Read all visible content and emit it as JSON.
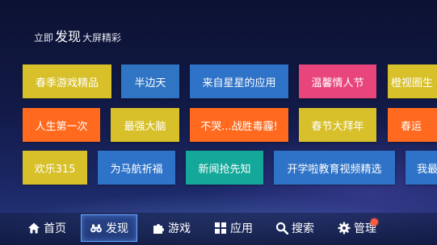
{
  "header": {
    "prefix": "立即",
    "emphasis": "发现",
    "suffix": "大屏精彩"
  },
  "tiles": [
    {
      "label": "春季游戏精品",
      "color": "#d8c02a"
    },
    {
      "label": "半边天",
      "color": "#2f75c4"
    },
    {
      "label": "来自星星的应用",
      "color": "#2f73c8"
    },
    {
      "label": "温馨情人节",
      "color": "#e8457c"
    },
    {
      "label": "橙视圈生",
      "color": "#d8c02a"
    },
    {
      "label": "人生第一次",
      "color": "#ff6a1e"
    },
    {
      "label": "最强大脑",
      "color": "#d8c02a"
    },
    {
      "label": "不哭...战胜毒霾!",
      "color": "#ff6a1e"
    },
    {
      "label": "春节大拜年",
      "color": "#d8c02a"
    },
    {
      "label": "春运",
      "color": "#ff6a1e"
    },
    {
      "label": "欢乐315",
      "color": "#d8c02a"
    },
    {
      "label": "为马航祈福",
      "color": "#2f73c8"
    },
    {
      "label": "新闻抢先知",
      "color": "#13a89a"
    },
    {
      "label": "开学啦教育视频精选",
      "color": "#2f73c8"
    },
    {
      "label": "我最",
      "color": "#2f73c8"
    }
  ],
  "nav": [
    {
      "label": "首页",
      "icon": "home-icon",
      "active": false
    },
    {
      "label": "发现",
      "icon": "binoculars-icon",
      "active": true
    },
    {
      "label": "游戏",
      "icon": "puzzle-icon",
      "active": false
    },
    {
      "label": "应用",
      "icon": "apps-grid-icon",
      "active": false
    },
    {
      "label": "搜索",
      "icon": "search-icon",
      "active": false
    },
    {
      "label": "管理",
      "icon": "gear-icon",
      "active": false,
      "badge": true
    }
  ],
  "colors": {
    "accent": "#6aa8ff",
    "badge": "#ff5b3d"
  }
}
